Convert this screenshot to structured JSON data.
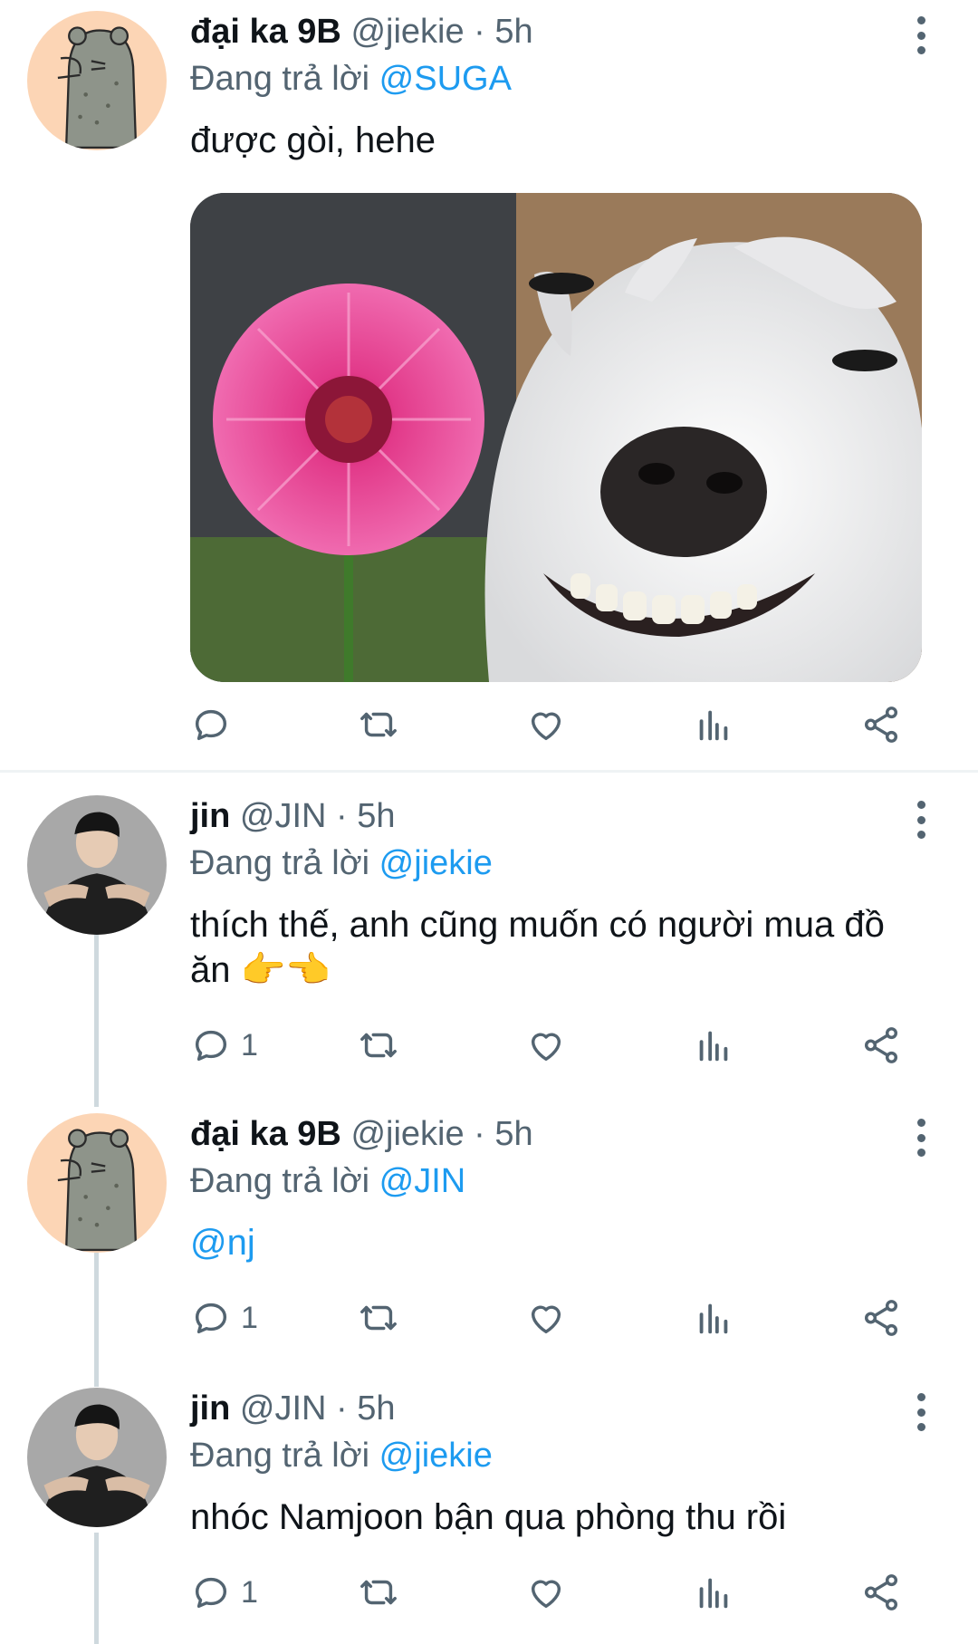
{
  "tweets": [
    {
      "name": "đại ka 9B",
      "handle": "@jiekie",
      "time": "· 5h",
      "reply_prefix": "Đang trả lời",
      "reply_to": "@SUGA",
      "text": "được gòi, hehe",
      "reply_count": "",
      "has_media": true
    },
    {
      "name": "jin",
      "handle": "@JIN",
      "time": "· 5h",
      "reply_prefix": "Đang trả lời",
      "reply_to": "@jiekie",
      "text": "thích thế, anh cũng muốn có người mua đồ ăn 👉👈",
      "reply_count": "1"
    },
    {
      "name": "đại ka 9B",
      "handle": "@jiekie",
      "time": "· 5h",
      "reply_prefix": "Đang trả lời",
      "reply_to": "@JIN",
      "text": "@nj",
      "reply_count": "1"
    },
    {
      "name": "jin",
      "handle": "@JIN",
      "time": "· 5h",
      "reply_prefix": "Đang trả lời",
      "reply_to": "@jiekie",
      "text": "nhóc Namjoon bận qua phòng thu rồi",
      "reply_count": "1"
    }
  ],
  "icons": {
    "reply": "reply-icon",
    "retweet": "retweet-icon",
    "like": "heart-icon",
    "views": "analytics-icon",
    "share": "share-icon",
    "more": "more-vertical-icon"
  },
  "colors": {
    "mention": "#1d9bf0",
    "muted": "#536471",
    "thread_line": "#cfd9de",
    "avatar_cat_bg": "#fcd5b5",
    "avatar_jin_bg": "#3a3a3a"
  }
}
